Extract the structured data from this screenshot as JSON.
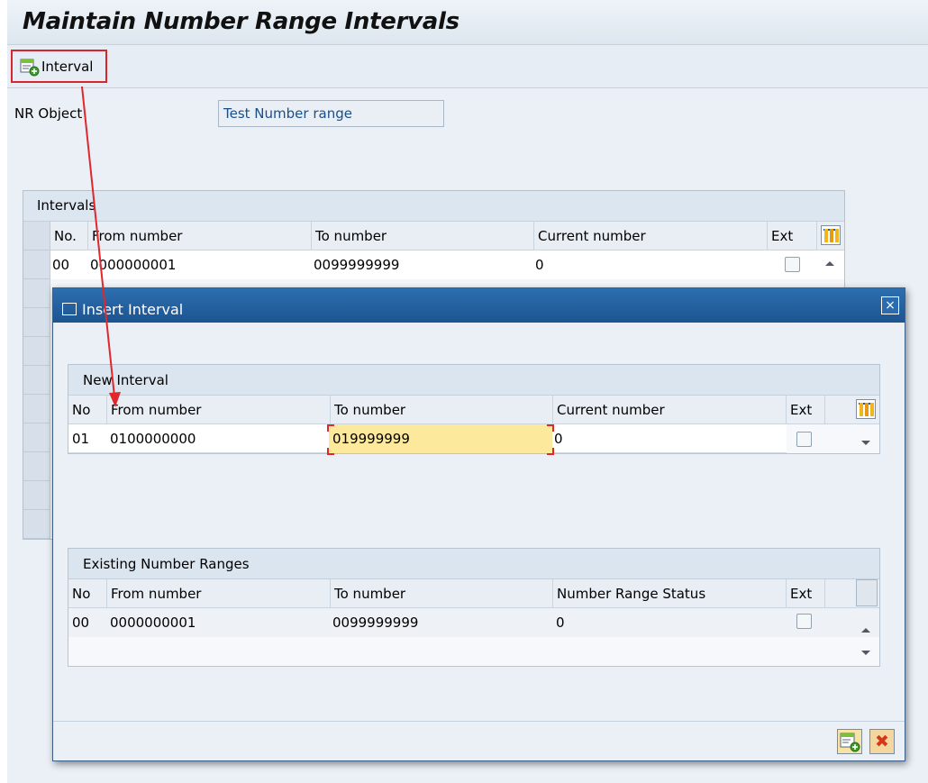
{
  "title": "Maintain Number Range Intervals",
  "toolbar": {
    "interval_label": "Interval"
  },
  "nr_object": {
    "label": "NR Object",
    "value": "Test Number range"
  },
  "intervals": {
    "title": "Intervals",
    "columns": [
      "No.",
      "From number",
      "To number",
      "Current number",
      "Ext"
    ],
    "rows": [
      {
        "no": "00",
        "from": "0000000001",
        "to": "0099999999",
        "current": "0",
        "ext": false
      }
    ]
  },
  "dialog": {
    "title": "Insert Interval",
    "close_label": "×",
    "new_interval": {
      "title": "New Interval",
      "columns": [
        "No",
        "From number",
        "To number",
        "Current number",
        "Ext"
      ],
      "row": {
        "no": "01",
        "from": "0100000000",
        "to": "019999999",
        "current": "0",
        "ext": false
      }
    },
    "existing": {
      "title": "Existing Number Ranges",
      "columns": [
        "No",
        "From number",
        "To number",
        "Number Range Status",
        "Ext"
      ],
      "rows": [
        {
          "no": "00",
          "from": "0000000001",
          "to": "0099999999",
          "status": "0",
          "ext": false
        }
      ]
    },
    "cancel_label": "✖"
  },
  "colors": {
    "highlight": "#fde99c",
    "annotation": "#e0272c",
    "dialog_header": "#1f5a99"
  },
  "icons": [
    "insert-interval-icon",
    "column-settings-icon",
    "close-icon",
    "scroll-up-icon",
    "scroll-down-icon",
    "cancel-icon"
  ]
}
